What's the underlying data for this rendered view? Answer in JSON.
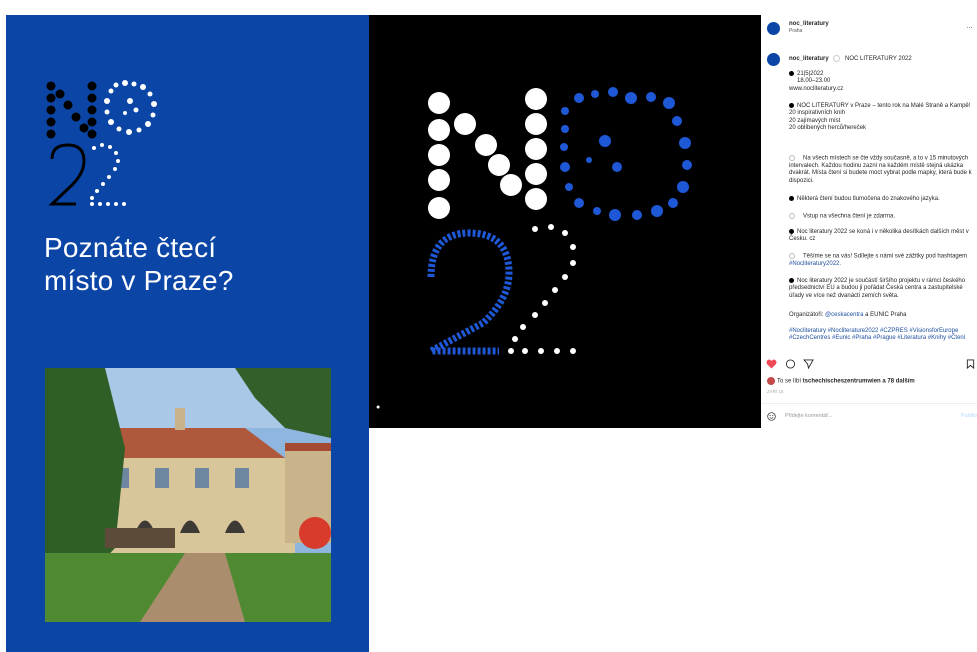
{
  "poster": {
    "logo_text": "NOC 22",
    "heading_line1": "Poznáte čtecí",
    "heading_line2": "místo v Praze?",
    "bg_color": "#0b46a6"
  },
  "instagram": {
    "author": {
      "username": "noc_literatury",
      "location": "Praha"
    },
    "caption_username": "noc_literatury",
    "caption_title": "NOC LITERATURY 2022",
    "lines": {
      "date": "21|5|2022",
      "time": "18.00–23.00",
      "url": "www.nocliteratury.cz",
      "intro": "NOC LITERATURY v Praze – tento rok na Malé Straně a Kampě!",
      "stat1": "20 inspirativních knih",
      "stat2": "20 zajímavých míst",
      "stat3": "20 oblíbených herců/hereček",
      "p1": "Na všech místech se čte vždy současně, a to v 15 minutových intervalech. Každou hodinu zazní na každém místě stejná ukázka dvakrát. Místa čtení si budete moct vybrat podle mapky, která bude k dispozici.",
      "p2": "Některá čtení budou tlumočena do znakového jazyka.",
      "p3": "Vstup na všechna čtení je zdarma.",
      "p4": "Noc literatury 2022 se koná i v několika desítkách dalších měst v Česku. cz",
      "p5_a": "Těšíme se na vás! Sdílejte s námi své zážitky pod hashtagem",
      "p5_tag": "#Nocliteratury2022.",
      "p6": "Noc literatury 2022 je součástí širšího projektu v rámci českého předsednictví EU a budou ji pořádat Česká centra a zastupitelské úřady ve více než dvanácti zemích světa.",
      "org_a": "Organizátoři: ",
      "org_tag": "@ceskacentra",
      "org_b": " a EUNIC Praha",
      "hashtags": "#Nocliteratury #Nocliterature2022 #CZPRES #VisionsforEurope #CzechCentres #Eunic #Praha #Prague #Literatura #Knihy #Čtení"
    },
    "likes_prefix": "To se líbí ",
    "likes_user": "tschechischeszentrumwien",
    "likes_suffix": " a 78 dalším",
    "timestamp": "ZÁŘÍ 15",
    "comment_placeholder": "Přidejte komentář...",
    "post_button": "Publikovat",
    "more_icon": "…"
  },
  "colors": {
    "accent_blue": "#0b46a6",
    "like_red": "#ed4956"
  }
}
